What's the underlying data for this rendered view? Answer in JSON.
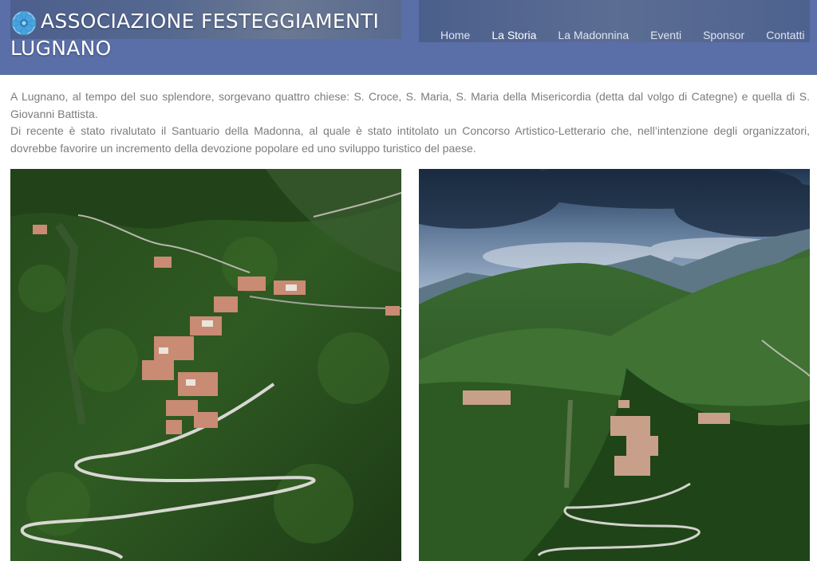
{
  "header": {
    "title": "ASSOCIAZIONE FESTEGGIAMENTI LUGNANO",
    "logo_icon": "flower-logo-icon",
    "colors": {
      "bar": "#5a6fa8",
      "text": "#ffffff"
    }
  },
  "nav": {
    "items": [
      {
        "label": "Home",
        "active": false
      },
      {
        "label": "La Storia",
        "active": true
      },
      {
        "label": "La Madonnina",
        "active": false
      },
      {
        "label": "Eventi",
        "active": false
      },
      {
        "label": "Sponsor",
        "active": false
      },
      {
        "label": "Contatti",
        "active": false
      }
    ]
  },
  "content": {
    "paragraphs": [
      "A Lugnano, al tempo del suo splendore, sorgevano quattro chiese: S. Croce, S. Maria, S. Maria della Misericordia (detta dal volgo di Categne) e quella di S. Giovanni Battista.",
      "Di recente è stato rivalutato il Santuario della Madonna, al quale è stato intitolato un Concorso Artistico-Letterario che, nell’intenzione degli organizzatori, dovrebbe favorire un incremento della devozione popolare ed uno sviluppo turistico del paese."
    ],
    "text_color": "#7c7c7c"
  }
}
